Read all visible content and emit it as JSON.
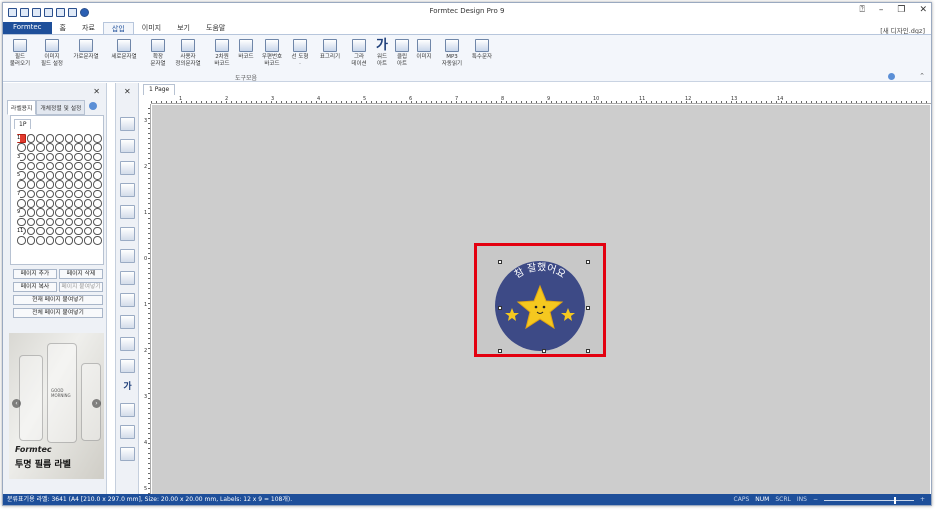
{
  "window": {
    "title": "Formtec Design Pro 9",
    "doc_name": "[새 디자인.dgz]"
  },
  "ribbon_tabs": [
    {
      "label": "Formtec",
      "kind": "file"
    },
    {
      "label": "홈",
      "kind": "normal"
    },
    {
      "label": "자료",
      "kind": "normal"
    },
    {
      "label": "삽입",
      "kind": "active"
    },
    {
      "label": "이미지",
      "kind": "normal"
    },
    {
      "label": "보기",
      "kind": "normal"
    },
    {
      "label": "도움말",
      "kind": "normal"
    }
  ],
  "ribbon": {
    "buttons": [
      {
        "l1": "필드",
        "l2": "불러오기"
      },
      {
        "l1": "이미지",
        "l2": "필드 설정"
      },
      {
        "l1": "가로문자열",
        "l2": ""
      },
      {
        "l1": "세로문자열",
        "l2": ""
      },
      {
        "l1": "확장",
        "l2": "문자열"
      },
      {
        "l1": "사용자",
        "l2": "정의문자열"
      },
      {
        "l1": "2차원",
        "l2": "바코드"
      },
      {
        "l1": "바코드",
        "l2": ""
      },
      {
        "l1": "우편번호",
        "l2": "바코드"
      },
      {
        "l1": "선 도형",
        "l2": "·"
      },
      {
        "l1": "표그리기",
        "l2": ""
      },
      {
        "l1": "그라",
        "l2": "데이션"
      },
      {
        "l1": "워드",
        "l2": "아트"
      },
      {
        "l1": "클립",
        "l2": "아트"
      },
      {
        "l1": "이미지",
        "l2": ""
      },
      {
        "l1": "MP3",
        "l2": "자동읽기"
      },
      {
        "l1": "특수문자",
        "l2": ""
      }
    ],
    "group_label": "도구모음",
    "wordart_glyph": "가"
  },
  "left_panel": {
    "tabs": [
      "라벨용지",
      "개체정렬 및 설정"
    ],
    "page_tab": "1P",
    "row_numbers": [
      "1",
      "3",
      "5",
      "7",
      "9",
      "11"
    ],
    "buttons": {
      "add_page": "페이지 추가",
      "delete_page": "페이지 삭제",
      "copy_page": "페이지 복사",
      "paste_page": "페이지 붙여넣기",
      "paste_current": "현재 페이지 붙여넣기",
      "paste_all": "전체 페이지 붙여넣기"
    },
    "ad": {
      "logo": "Formtec",
      "title": "투명 필름 라벨",
      "bottle_text": "GOOD MORNING"
    }
  },
  "document": {
    "tab": "1 Page",
    "label_text": "참 잘했어요",
    "hruler_numbers": [
      "1",
      "2",
      "3",
      "4",
      "5",
      "6",
      "7",
      "8",
      "9",
      "10",
      "11",
      "12",
      "13",
      "14"
    ],
    "vruler_numbers": [
      "3",
      "2",
      "1",
      "0",
      "1",
      "2",
      "3",
      "4",
      "5"
    ]
  },
  "colors": {
    "accent": "#1e4f9a",
    "selection": "#e3000f",
    "badge_circle": "#3d4a86",
    "star": "#f5c81f"
  },
  "status": {
    "text": "분류표기용 라벨: 3641 (A4 [210.0 x 297.0 mm], Size: 20.00 x 20.00 mm, Labels: 12 x 9 = 108개).",
    "caps": "CAPS",
    "num": "NUM",
    "scrl": "SCRL",
    "ins": "INS",
    "zoom_minus": "−",
    "zoom_plus": "+"
  }
}
